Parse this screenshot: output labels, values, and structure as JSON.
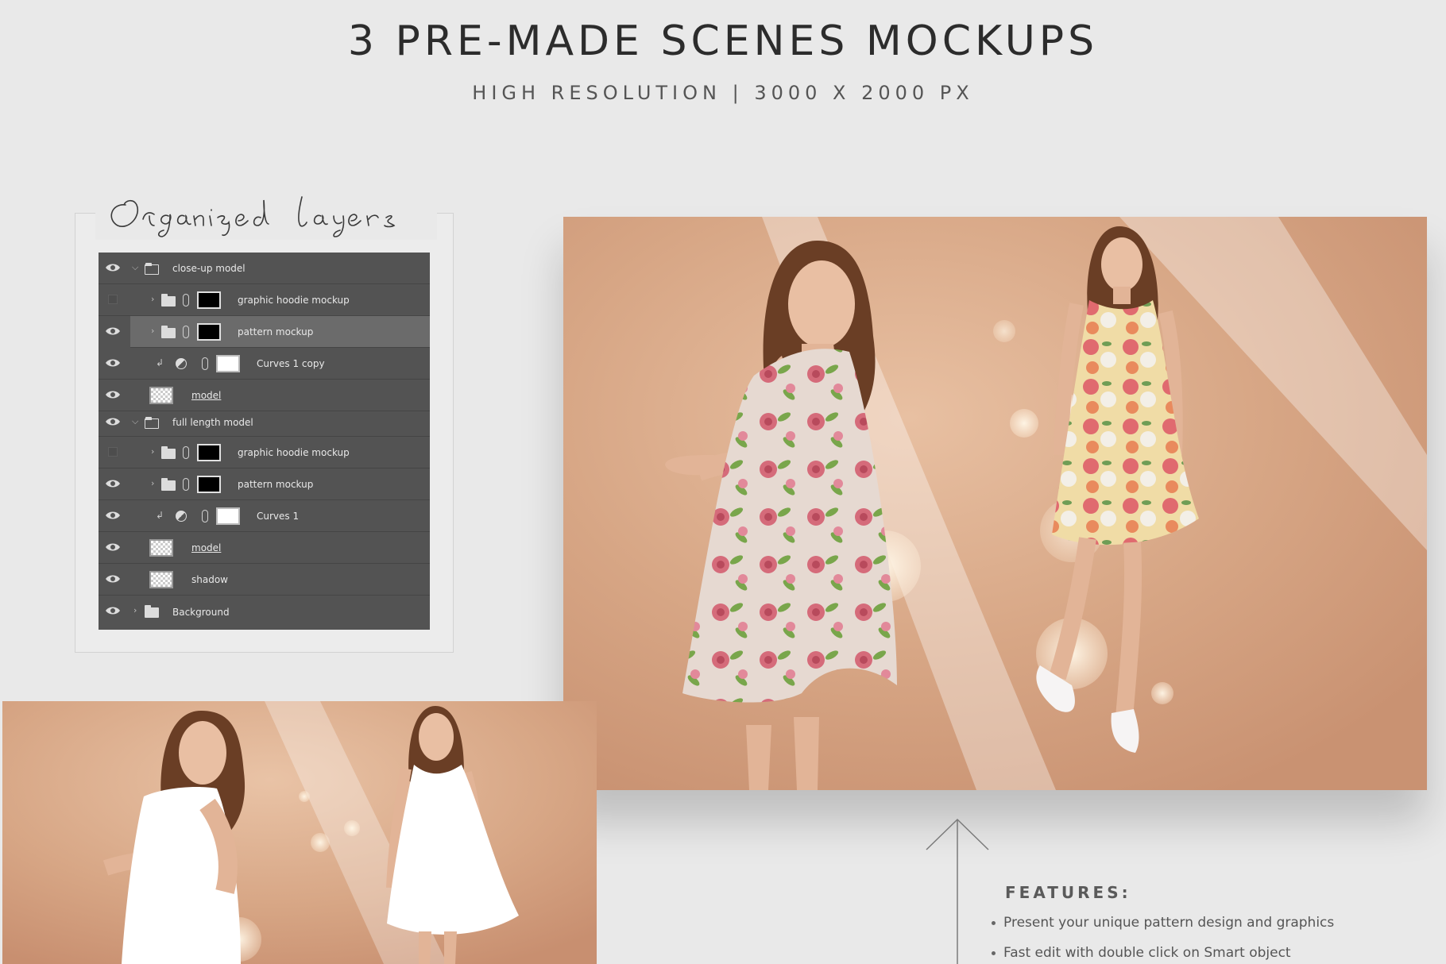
{
  "header": {
    "title": "3 PRE-MADE SCENES MOCKUPS",
    "subtitle": "HIGH RESOLUTION | 3000 X 2000 PX"
  },
  "layers_section": {
    "script_title": "Organised layers",
    "layers": [
      {
        "name": "close-up model",
        "visible": true,
        "kind": "group-open"
      },
      {
        "name": "graphic hoodie mockup",
        "visible": false,
        "kind": "smart-group"
      },
      {
        "name": "pattern mockup",
        "visible": true,
        "kind": "smart-group",
        "selected": true
      },
      {
        "name": "Curves 1 copy",
        "visible": true,
        "kind": "adjustment"
      },
      {
        "name": "model",
        "visible": true,
        "kind": "pixel"
      },
      {
        "name": "full length model",
        "visible": true,
        "kind": "group-open"
      },
      {
        "name": "graphic hoodie mockup",
        "visible": false,
        "kind": "smart-group"
      },
      {
        "name": "pattern mockup",
        "visible": true,
        "kind": "smart-group"
      },
      {
        "name": "Curves 1",
        "visible": true,
        "kind": "adjustment"
      },
      {
        "name": "model",
        "visible": true,
        "kind": "pixel"
      },
      {
        "name": "shadow",
        "visible": true,
        "kind": "pixel"
      },
      {
        "name": "Background",
        "visible": true,
        "kind": "group-closed"
      }
    ]
  },
  "features": {
    "title": "FEATURES:",
    "items": [
      "Present your unique pattern design and graphics",
      "Fast edit with double click on Smart object"
    ]
  },
  "colors": {
    "background": "#e9e9e9",
    "panel": "#535353",
    "peach": "#d9a887",
    "dress_floral_light": "#e8ddd6",
    "dress_floral_yellow": "#f0dca6",
    "dress_white": "#ffffff"
  }
}
